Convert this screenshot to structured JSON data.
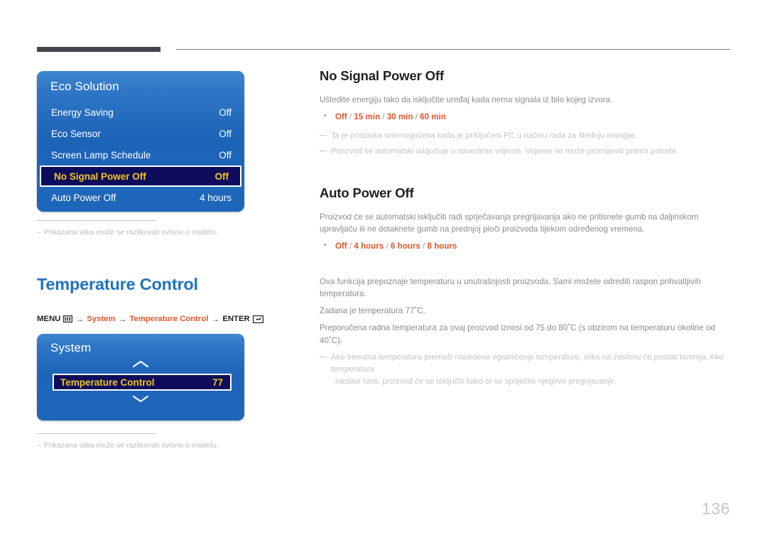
{
  "page": {
    "number": "136"
  },
  "osd_eco": {
    "title": "Eco Solution",
    "rows": [
      {
        "label": "Energy Saving",
        "value": "Off"
      },
      {
        "label": "Eco Sensor",
        "value": "Off"
      },
      {
        "label": "Screen Lamp Schedule",
        "value": "Off"
      },
      {
        "label": "No Signal Power Off",
        "value": "Off"
      },
      {
        "label": "Auto Power Off",
        "value": "4 hours"
      }
    ],
    "note": "Prikazana slika može se razlikovati ovisno o modelu.",
    "note_dash": "–"
  },
  "osd_system": {
    "title": "System",
    "selected_label": "Temperature Control",
    "selected_value": "77",
    "note": "Prikazana slika može se razlikovati ovisno o modelu.",
    "note_dash": "–"
  },
  "section_no_signal": {
    "title": "No Signal Power Off",
    "paragraph": "Uštedite energiju tako da isključite uređaj kada nema signala iz bilo kojeg izvora.",
    "options": "Off / 15 min / 30 min / 60 min",
    "note1": "Ta je postavka onemogućena kada je priključeni PC u načinu rada za štednju energije.",
    "note2": "Proizvod se automatski isključuje u navedeno vrijeme. Vrijeme se može promijeniti prema potrebi."
  },
  "section_auto_power": {
    "title": "Auto Power Off",
    "paragraph": "Proizvod će se automatski isključiti radi sprječavanja pregrijavanja ako ne pritisnete gumb na daljinskom upravljaču ili ne dotaknete gumb na prednjoj ploči proizvoda tijekom određenog vremena.",
    "options": "Off / 4 hours / 6 hours / 8 hours"
  },
  "section_temperature": {
    "title": "Temperature Control",
    "menu_path": {
      "menu_label": "MENU",
      "arrow": "→",
      "item1": "System",
      "item2": "Temperature Control",
      "enter_label": "ENTER"
    },
    "paragraph1": "Ova funkcija prepoznaje temperaturu u unutrašnjosti proizvoda. Sami možete odrediti raspon prihvatljivih temperatura.",
    "paragraph2": "Zadana je temperatura 77˚C.",
    "paragraph3": "Preporučena radna temperatura za ovaj proizvod iznosi od 75 do 80˚C (s obzirom na temperaturu okoline od 40˚C).",
    "note1": "Ako trenutna temperatura premaši navedeno ograničenje temperature, slika na zaslonu će postati tamnija. Ako temperatura",
    "note1_cont": "nastavi rasti, proizvod će se isključiti kako bi se spriječilo njegovo pregrijavanje."
  },
  "colors": {
    "accent_orange": "#e4552b",
    "heading_blue": "#1f72c0",
    "osd_blue": "#1d63b8",
    "osd_selected_bg": "#0d0d5c",
    "osd_selected_text": "#f5c518",
    "muted_text": "#8b8b93"
  }
}
